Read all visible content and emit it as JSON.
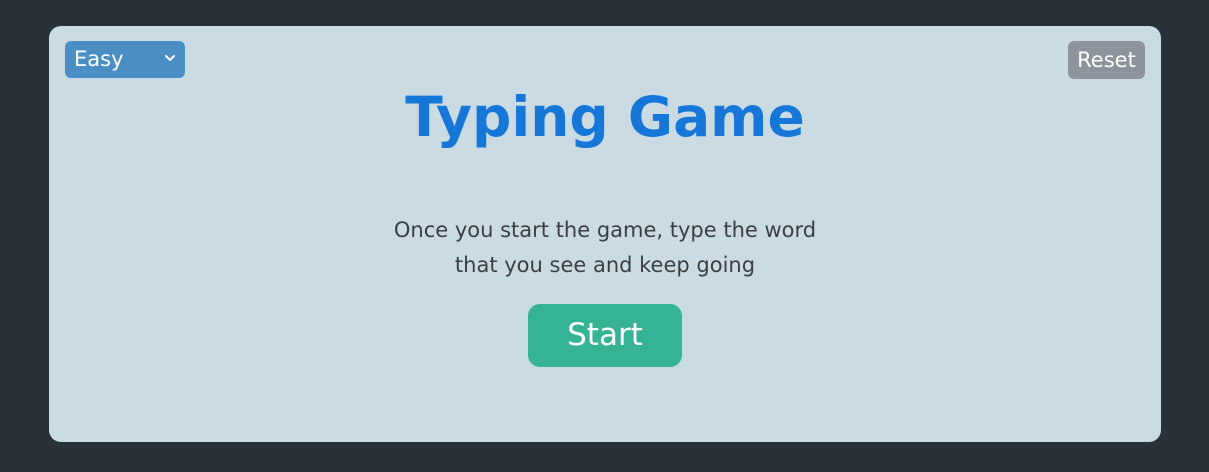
{
  "difficulty": {
    "selected": "Easy",
    "icon": "chevron-down-icon"
  },
  "reset_label": "Reset",
  "title": "Typing Game",
  "instructions": {
    "line1": "Once you start the game, type the word",
    "line2": "that you see and keep going"
  },
  "start_label": "Start",
  "colors": {
    "page_background": "#283038",
    "card_background": "#cbdbe3",
    "title": "#1677d8",
    "difficulty_select": "#4a8ec4",
    "reset_button": "#8c939c",
    "start_button": "#36b394",
    "body_text": "#3b3f44"
  }
}
